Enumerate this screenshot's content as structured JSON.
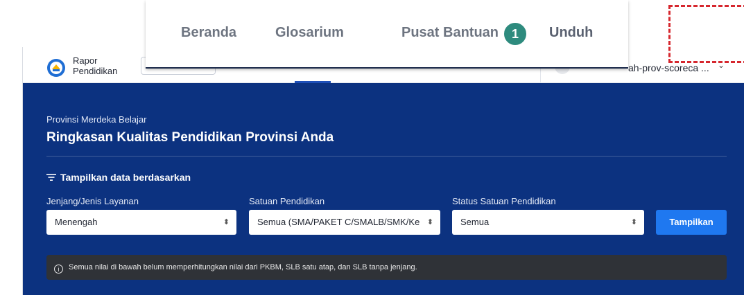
{
  "header": {
    "brand_line1": "Rapor",
    "brand_line2": "Pendidikan",
    "account_name": "ah-prov-scoreca ...",
    "account_chevron": "⌄"
  },
  "nav": {
    "items": [
      "Beranda",
      "Glosarium",
      "Pusat Bantuan",
      "Unduh"
    ],
    "highlighted": "Unduh"
  },
  "annotation": {
    "marker_label": "1",
    "marker_color": "#2e8b7e",
    "highlight_color": "#d6272e"
  },
  "hero": {
    "province_name": "Provinsi Merdeka Belajar",
    "title": "Ringkasan Kualitas Pendidikan Provinsi Anda",
    "background": "#0c3280"
  },
  "filters": {
    "header": "Tampilkan data berdasarkan",
    "icon": "filter-icon",
    "fields": [
      {
        "label": "Jenjang/Jenis Layanan",
        "value": "Menengah"
      },
      {
        "label": "Satuan Pendidikan",
        "value": "Semua (SMA/PAKET C/SMALB/SMK/Ke"
      },
      {
        "label": "Status Satuan Pendidikan",
        "value": "Semua"
      }
    ],
    "submit_label": "Tampilkan",
    "submit_color": "#1f78f0"
  },
  "notice": {
    "icon": "info-icon",
    "text": "Semua nilai di bawah belum memperhitungkan nilai dari PKBM, SLB satu atap, dan SLB tanpa jenjang."
  }
}
